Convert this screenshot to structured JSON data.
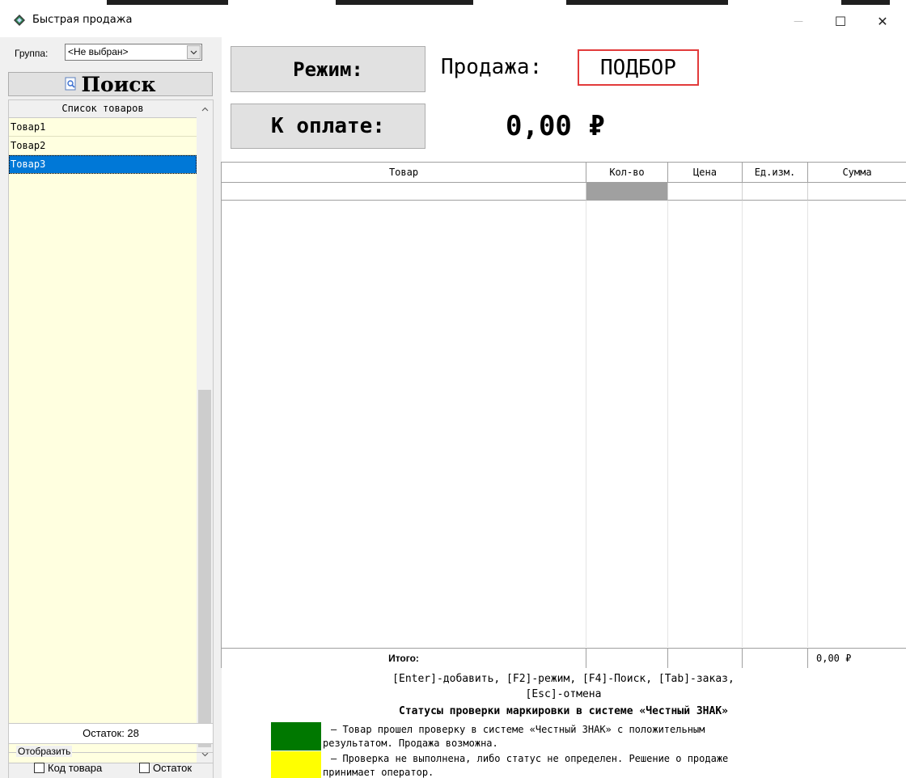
{
  "window": {
    "title": "Быстрая продажа",
    "minimize_glyph": "—",
    "maximize_glyph": "☐",
    "close_glyph": "✕"
  },
  "left": {
    "group_label": "Группа:",
    "group_value": "<Не выбран>",
    "search_label": "Поиск",
    "list_header": "Список товаров",
    "items": [
      "Товар1",
      "Товар2",
      "Товар3"
    ],
    "selected_index": 2,
    "remain": "Остаток: 28",
    "display_legend": "Отобразить",
    "check_code": "Код товара",
    "check_remain": "Остаток"
  },
  "main": {
    "mode_button": "Режим:",
    "pay_button": "К оплате:",
    "sale_label": "Продажа:",
    "sale_mode": "ПОДБОР",
    "amount": "0,00 ₽"
  },
  "table": {
    "columns": [
      "Товар",
      "Кол-во",
      "Цена",
      "Ед.изм.",
      "Сумма"
    ],
    "total_label": "Итого:",
    "total_sum": "0,00 ₽"
  },
  "hints": {
    "line1": "[Enter]-добавить, [F2]-режим, [F4]-Поиск, [Tab]-заказ,",
    "line2": "[Esc]-отмена"
  },
  "statuses": {
    "title": "Статусы проверки маркировки в системе «Честный ЗНАК»",
    "green_line1": "–   Товар прошел проверку в системе «Честный ЗНАК» с положительным",
    "green_line2": "результатом. Продажа возможна.",
    "yellow_line1": "–   Проверка не выполнена, либо статус не определен. Решение о продаже",
    "yellow_line2": "принимает оператор."
  },
  "colors": {
    "accent_selected": "#0078d7",
    "list_background": "#ffffe0",
    "mode_border": "#e23b3b",
    "status_green": "#007800",
    "status_yellow": "#ffff00"
  }
}
